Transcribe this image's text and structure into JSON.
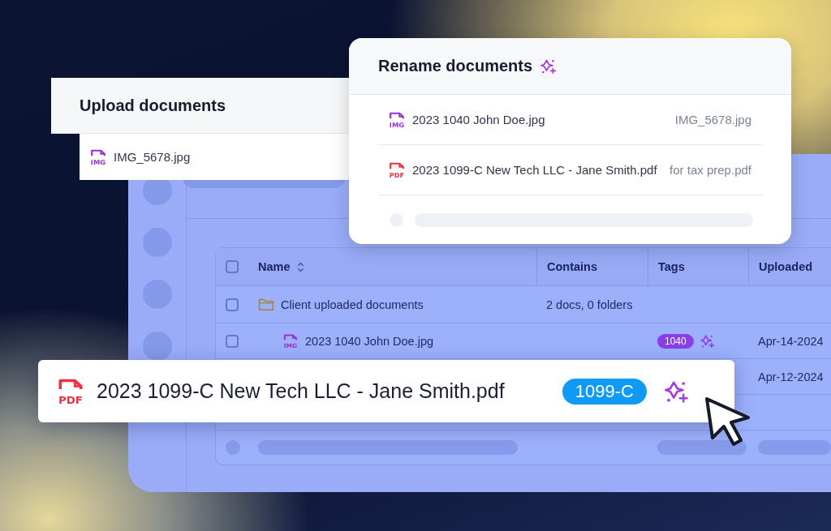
{
  "upload_panel": {
    "title": "Upload documents",
    "files": [
      {
        "kind": "img",
        "type_label": "IMG",
        "name": "IMG_5678.jpg"
      }
    ]
  },
  "rename_panel": {
    "title": "Rename documents",
    "rows": [
      {
        "kind": "img",
        "type_label": "IMG",
        "new_name": "2023 1040 John Doe.jpg",
        "old_name": "IMG_5678.jpg"
      },
      {
        "kind": "pdf",
        "type_label": "PDF",
        "new_name": "2023 1099-C New Tech LLC - Jane Smith.pdf",
        "old_name": "for tax prep.pdf"
      }
    ]
  },
  "table": {
    "all_checked": false,
    "columns": [
      "Name",
      "Contains",
      "Tags",
      "Uploaded"
    ],
    "rows": [
      {
        "kind": "folder",
        "checked": false,
        "name": "Client uploaded documents",
        "contains": "2 docs, 0 folders"
      },
      {
        "kind": "img",
        "type_label": "IMG",
        "checked": false,
        "name": "2023 1040 John Doe.jpg",
        "tag": {
          "label": "1040",
          "color": "#8a3ee8"
        },
        "uploaded": "Apr-14-2024"
      },
      {
        "kind": "hidden",
        "uploaded": "Apr-12-2024"
      }
    ]
  },
  "floating_row": {
    "kind": "pdf",
    "type_label": "PDF",
    "name": "2023 1099-C New Tech LLC - Jane Smith.pdf",
    "tag": {
      "label": "1099-C",
      "color": "#0e9af5"
    }
  }
}
